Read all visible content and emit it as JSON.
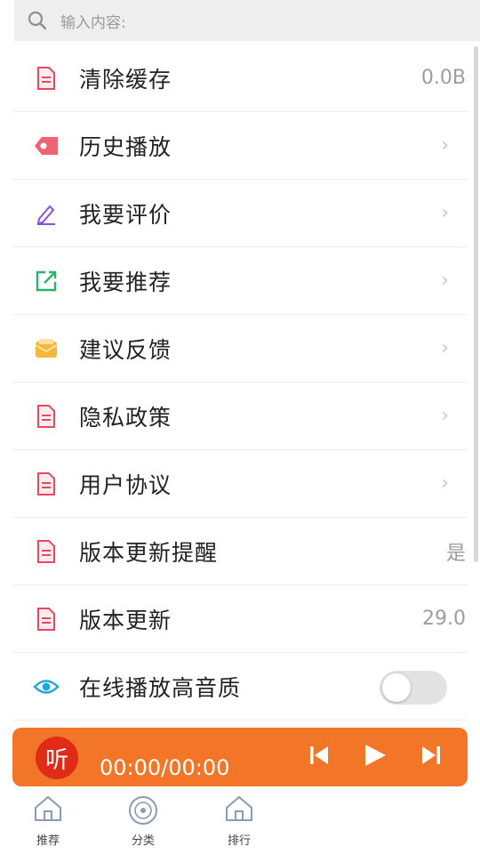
{
  "search": {
    "placeholder": "输入内容:"
  },
  "settings": [
    {
      "label": "清除缓存",
      "icon": "document-icon",
      "value": "0.0B"
    },
    {
      "label": "历史播放",
      "icon": "history-tag-icon"
    },
    {
      "label": "我要评价",
      "icon": "pencil-icon"
    },
    {
      "label": "我要推荐",
      "icon": "share-icon"
    },
    {
      "label": "建议反馈",
      "icon": "mail-icon"
    },
    {
      "label": "隐私政策",
      "icon": "document-icon"
    },
    {
      "label": "用户协议",
      "icon": "document-icon"
    },
    {
      "label": "版本更新提醒",
      "icon": "document-icon",
      "value": "是"
    },
    {
      "label": "版本更新",
      "icon": "document-icon",
      "value": "29.0"
    },
    {
      "label": "在线播放高音质",
      "icon": "eye-icon",
      "toggle": false
    }
  ],
  "player": {
    "logo_text": "听",
    "time": "00:00/00:00"
  },
  "tabs": [
    {
      "label": "推荐",
      "icon": "home-icon"
    },
    {
      "label": "分类",
      "icon": "disc-icon"
    },
    {
      "label": "排行",
      "icon": "home-icon"
    }
  ],
  "colors": {
    "accent": "#f37528",
    "logo_red": "#e02b17",
    "doc_icon": "#e8495e"
  }
}
